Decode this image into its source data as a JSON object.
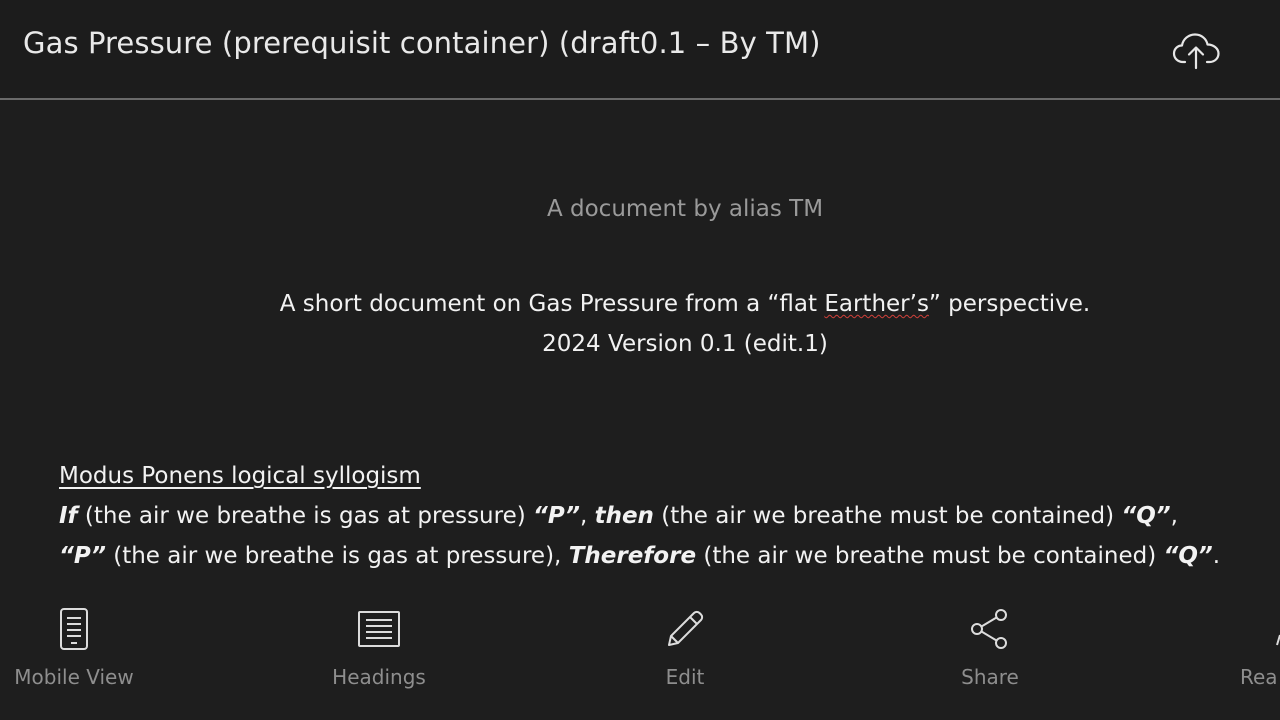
{
  "header": {
    "title": "Gas Pressure (prerequisit container) (draft0.1 – By TM)",
    "upload_icon": "cloud-upload-icon"
  },
  "document": {
    "author_line": "A document by alias TM",
    "description": {
      "before": "A short document on Gas Pressure from a “flat ",
      "flagged_word": "Earther’s",
      "after": "” perspective."
    },
    "version_line": "2024 Version 0.1 (edit.1)",
    "section_heading": "Modus Ponens logical syllogism",
    "syllogism": {
      "line1": {
        "if": "If",
        "premise_a": " (the air we breathe is gas at pressure) ",
        "p": "“P”",
        "comma": ", ",
        "then": "then",
        "premise_b": " (the air we breathe must be contained) ",
        "q": "“Q”",
        "end": ","
      },
      "line2": {
        "p": "“P”",
        "premise_a": " (the air we breathe is gas at pressure), ",
        "therefore": "Therefore",
        "premise_b": " (the air we breathe must be contained) ",
        "q": "“Q”",
        "end": "."
      }
    }
  },
  "bottom_nav": {
    "items": [
      {
        "label": "Mobile View",
        "icon": "mobile-view-icon"
      },
      {
        "label": "Headings",
        "icon": "headings-list-icon"
      },
      {
        "label": "Edit",
        "icon": "pencil-icon"
      },
      {
        "label": "Share",
        "icon": "share-icon"
      },
      {
        "label": "Rea",
        "icon": "read-aloud-icon"
      }
    ]
  },
  "colors": {
    "background": "#1e1e1e",
    "divider": "#6a6a6a",
    "nav_label": "#8e8e8e",
    "spellcheck": "#d0403a"
  }
}
